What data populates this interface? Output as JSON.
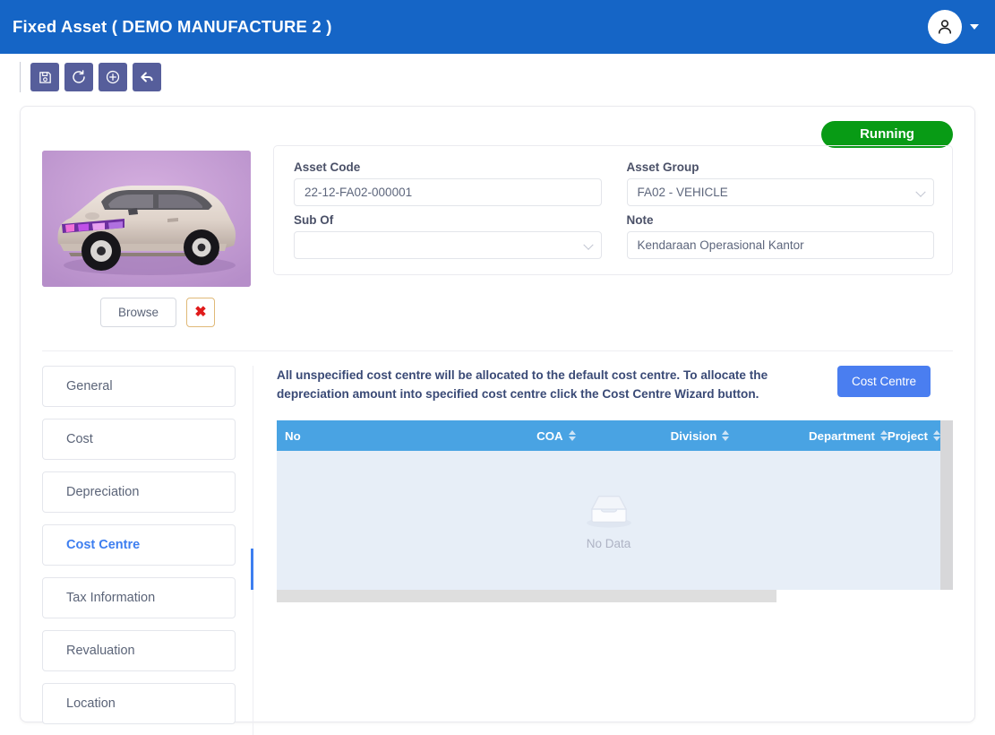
{
  "header": {
    "title": "Fixed Asset ( DEMO MANUFACTURE 2 )",
    "brand_color": "#1565c6",
    "avatar_icon": "user-icon",
    "caret_icon": "chevron-down-icon"
  },
  "toolbar": {
    "buttons": [
      {
        "name": "save-button",
        "icon": "save-icon"
      },
      {
        "name": "refresh-button",
        "icon": "refresh-icon"
      },
      {
        "name": "add-button",
        "icon": "plus-circle-icon"
      },
      {
        "name": "back-button",
        "icon": "arrow-back-icon"
      }
    ]
  },
  "status": {
    "label": "Running",
    "color": "#089b15"
  },
  "photo": {
    "alt": "asset-photo-car",
    "browse_label": "Browse",
    "delete_label": "✖"
  },
  "fields": {
    "asset_code": {
      "label": "Asset Code",
      "value": "22-12-FA02-000001",
      "placeholder": ""
    },
    "asset_group": {
      "label": "Asset Group",
      "value": "FA02 - VEHICLE",
      "placeholder": ""
    },
    "sub_of": {
      "label": "Sub Of",
      "value": "",
      "placeholder": ""
    },
    "note": {
      "label": "Note",
      "value": "Kendaraan Operasional Kantor",
      "placeholder": ""
    }
  },
  "tabs": {
    "active": "Cost Centre",
    "items": [
      {
        "label": "General"
      },
      {
        "label": "Cost"
      },
      {
        "label": "Depreciation"
      },
      {
        "label": "Cost Centre"
      },
      {
        "label": "Tax Information"
      },
      {
        "label": "Revaluation"
      },
      {
        "label": "Location"
      }
    ],
    "active_color": "#3d7ef0"
  },
  "content": {
    "notice": "All unspecified cost centre will be allocated to the default cost centre. To allocate the depreciation amount into specified cost centre click the Cost Centre Wizard button.",
    "cost_centre_button": "Cost Centre",
    "table": {
      "header_color": "#49a3e3",
      "columns": [
        {
          "label": "No",
          "sortable": false
        },
        {
          "label": "COA",
          "sortable": true
        },
        {
          "label": "Division",
          "sortable": true
        },
        {
          "label": "Department",
          "sortable": true
        },
        {
          "label": "Project",
          "sortable": true
        }
      ],
      "rows": [],
      "empty_label": "No Data",
      "empty_icon": "inbox-icon"
    }
  }
}
